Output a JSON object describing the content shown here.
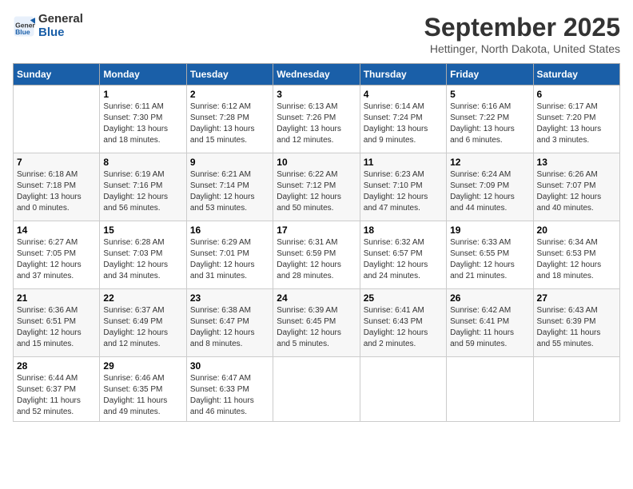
{
  "logo": {
    "line1": "General",
    "line2": "Blue"
  },
  "title": "September 2025",
  "location": "Hettinger, North Dakota, United States",
  "days_of_week": [
    "Sunday",
    "Monday",
    "Tuesday",
    "Wednesday",
    "Thursday",
    "Friday",
    "Saturday"
  ],
  "weeks": [
    [
      {
        "day": "",
        "info": ""
      },
      {
        "day": "1",
        "info": "Sunrise: 6:11 AM\nSunset: 7:30 PM\nDaylight: 13 hours\nand 18 minutes."
      },
      {
        "day": "2",
        "info": "Sunrise: 6:12 AM\nSunset: 7:28 PM\nDaylight: 13 hours\nand 15 minutes."
      },
      {
        "day": "3",
        "info": "Sunrise: 6:13 AM\nSunset: 7:26 PM\nDaylight: 13 hours\nand 12 minutes."
      },
      {
        "day": "4",
        "info": "Sunrise: 6:14 AM\nSunset: 7:24 PM\nDaylight: 13 hours\nand 9 minutes."
      },
      {
        "day": "5",
        "info": "Sunrise: 6:16 AM\nSunset: 7:22 PM\nDaylight: 13 hours\nand 6 minutes."
      },
      {
        "day": "6",
        "info": "Sunrise: 6:17 AM\nSunset: 7:20 PM\nDaylight: 13 hours\nand 3 minutes."
      }
    ],
    [
      {
        "day": "7",
        "info": "Sunrise: 6:18 AM\nSunset: 7:18 PM\nDaylight: 13 hours\nand 0 minutes."
      },
      {
        "day": "8",
        "info": "Sunrise: 6:19 AM\nSunset: 7:16 PM\nDaylight: 12 hours\nand 56 minutes."
      },
      {
        "day": "9",
        "info": "Sunrise: 6:21 AM\nSunset: 7:14 PM\nDaylight: 12 hours\nand 53 minutes."
      },
      {
        "day": "10",
        "info": "Sunrise: 6:22 AM\nSunset: 7:12 PM\nDaylight: 12 hours\nand 50 minutes."
      },
      {
        "day": "11",
        "info": "Sunrise: 6:23 AM\nSunset: 7:10 PM\nDaylight: 12 hours\nand 47 minutes."
      },
      {
        "day": "12",
        "info": "Sunrise: 6:24 AM\nSunset: 7:09 PM\nDaylight: 12 hours\nand 44 minutes."
      },
      {
        "day": "13",
        "info": "Sunrise: 6:26 AM\nSunset: 7:07 PM\nDaylight: 12 hours\nand 40 minutes."
      }
    ],
    [
      {
        "day": "14",
        "info": "Sunrise: 6:27 AM\nSunset: 7:05 PM\nDaylight: 12 hours\nand 37 minutes."
      },
      {
        "day": "15",
        "info": "Sunrise: 6:28 AM\nSunset: 7:03 PM\nDaylight: 12 hours\nand 34 minutes."
      },
      {
        "day": "16",
        "info": "Sunrise: 6:29 AM\nSunset: 7:01 PM\nDaylight: 12 hours\nand 31 minutes."
      },
      {
        "day": "17",
        "info": "Sunrise: 6:31 AM\nSunset: 6:59 PM\nDaylight: 12 hours\nand 28 minutes."
      },
      {
        "day": "18",
        "info": "Sunrise: 6:32 AM\nSunset: 6:57 PM\nDaylight: 12 hours\nand 24 minutes."
      },
      {
        "day": "19",
        "info": "Sunrise: 6:33 AM\nSunset: 6:55 PM\nDaylight: 12 hours\nand 21 minutes."
      },
      {
        "day": "20",
        "info": "Sunrise: 6:34 AM\nSunset: 6:53 PM\nDaylight: 12 hours\nand 18 minutes."
      }
    ],
    [
      {
        "day": "21",
        "info": "Sunrise: 6:36 AM\nSunset: 6:51 PM\nDaylight: 12 hours\nand 15 minutes."
      },
      {
        "day": "22",
        "info": "Sunrise: 6:37 AM\nSunset: 6:49 PM\nDaylight: 12 hours\nand 12 minutes."
      },
      {
        "day": "23",
        "info": "Sunrise: 6:38 AM\nSunset: 6:47 PM\nDaylight: 12 hours\nand 8 minutes."
      },
      {
        "day": "24",
        "info": "Sunrise: 6:39 AM\nSunset: 6:45 PM\nDaylight: 12 hours\nand 5 minutes."
      },
      {
        "day": "25",
        "info": "Sunrise: 6:41 AM\nSunset: 6:43 PM\nDaylight: 12 hours\nand 2 minutes."
      },
      {
        "day": "26",
        "info": "Sunrise: 6:42 AM\nSunset: 6:41 PM\nDaylight: 11 hours\nand 59 minutes."
      },
      {
        "day": "27",
        "info": "Sunrise: 6:43 AM\nSunset: 6:39 PM\nDaylight: 11 hours\nand 55 minutes."
      }
    ],
    [
      {
        "day": "28",
        "info": "Sunrise: 6:44 AM\nSunset: 6:37 PM\nDaylight: 11 hours\nand 52 minutes."
      },
      {
        "day": "29",
        "info": "Sunrise: 6:46 AM\nSunset: 6:35 PM\nDaylight: 11 hours\nand 49 minutes."
      },
      {
        "day": "30",
        "info": "Sunrise: 6:47 AM\nSunset: 6:33 PM\nDaylight: 11 hours\nand 46 minutes."
      },
      {
        "day": "",
        "info": ""
      },
      {
        "day": "",
        "info": ""
      },
      {
        "day": "",
        "info": ""
      },
      {
        "day": "",
        "info": ""
      }
    ]
  ]
}
